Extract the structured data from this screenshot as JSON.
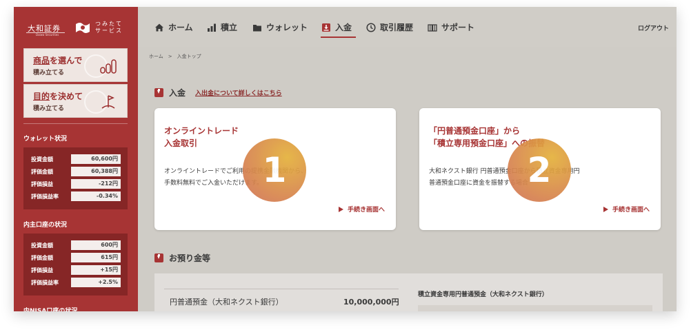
{
  "sidebar": {
    "brand": "大和証券",
    "brand_sub": "Daiwa Securities",
    "service": [
      "つ",
      "み",
      "た",
      "て",
      "サ",
      "ー",
      "ビ",
      "ス"
    ],
    "service_line1": "つみたて",
    "service_line2": "サービス",
    "card1": {
      "title_underlined": "商品",
      "title_rest": "を選んで",
      "sub": "積み立てる"
    },
    "card2": {
      "title_underlined": "目的",
      "title_rest": "を決めて",
      "sub": "積み立てる"
    },
    "wallet_title": "ウォレット状況",
    "wallet": [
      {
        "label": "投資金額",
        "value": "60,600円"
      },
      {
        "label": "評価金額",
        "value": "60,388円"
      },
      {
        "label": "評価損益",
        "value": "-212円"
      },
      {
        "label": "評価損益率",
        "value": "-0.34%"
      }
    ],
    "domestic_title": "内主口座の状況",
    "domestic": [
      {
        "label": "投資金額",
        "value": "600円"
      },
      {
        "label": "評価金額",
        "value": "615円"
      },
      {
        "label": "評価損益",
        "value": "+15円"
      },
      {
        "label": "評価損益率",
        "value": "+2.5%"
      }
    ],
    "nisa_title": "内NISA口座の状況"
  },
  "nav": {
    "items": [
      {
        "label": "ホーム",
        "icon": "home-icon"
      },
      {
        "label": "積立",
        "icon": "bar-chart-icon"
      },
      {
        "label": "ウォレット",
        "icon": "wallet-icon"
      },
      {
        "label": "入金",
        "icon": "deposit-icon"
      },
      {
        "label": "取引履歴",
        "icon": "clock-icon"
      },
      {
        "label": "サポート",
        "icon": "book-icon"
      }
    ],
    "active": "入金",
    "logout": "ログアウト"
  },
  "breadcrumb": "ホーム　>　入金トップ",
  "deposit": {
    "heading": "入金",
    "detail_link": "入出金について詳しくはこちら",
    "cards": [
      {
        "badge": "1",
        "title": "オンライントレード\n入金取引",
        "desc": "オンライントレードでご利用の提携金融機関から、\n手数料無料でご入金いただけます。",
        "action": "手続き画面へ"
      },
      {
        "badge": "2",
        "title": "「円普通預金口座」から\n「積立専用預金口座」への振替",
        "desc": "大和ネクスト銀行 円普通預金口座から積立資金専用円\n普通預金口座に資金を振替する場合",
        "action": "手続き画面へ"
      }
    ]
  },
  "balances": {
    "heading": "お預り金等",
    "left_label": "円普通預金（大和ネクスト銀行）",
    "left_value": "10,000,000円",
    "right_title": "積立資金専用円普通預金（大和ネクスト銀行）"
  },
  "colors": {
    "brand": "#a73434",
    "sidebar_dark": "#862626",
    "badge_from": "#e4b13a",
    "badge_to": "#cf6f5a"
  }
}
